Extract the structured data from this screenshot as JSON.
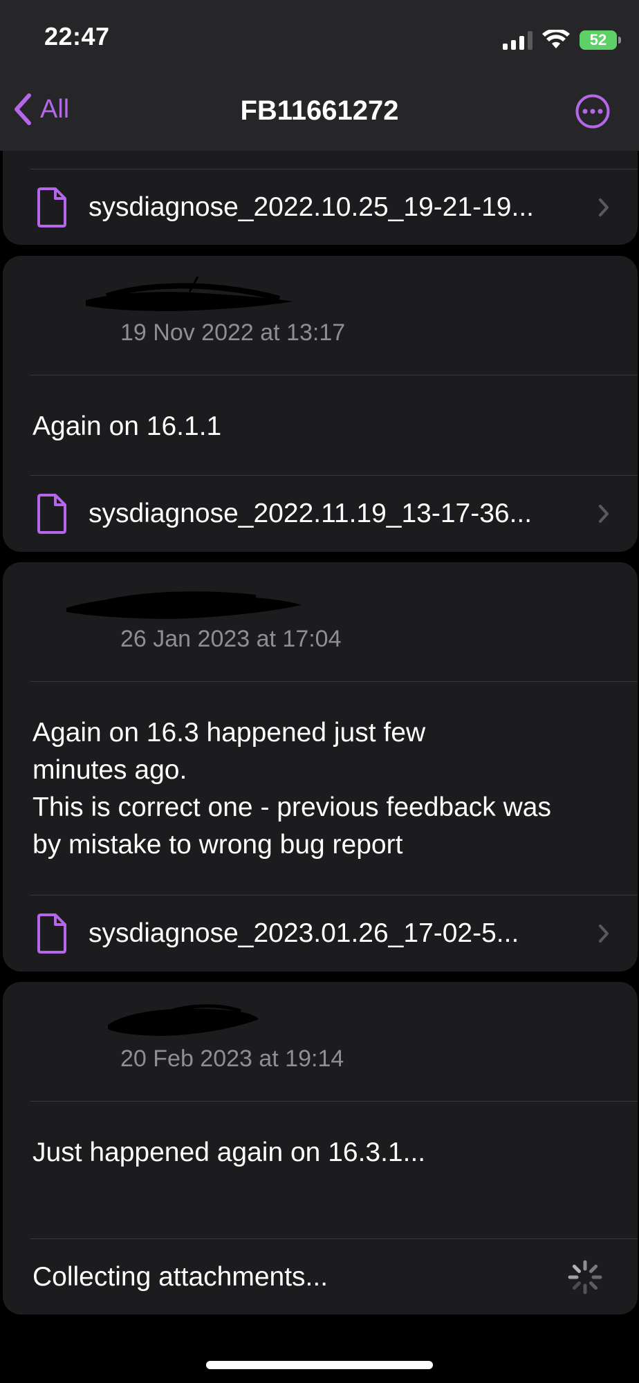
{
  "status_bar": {
    "time": "22:47",
    "battery": "52"
  },
  "nav": {
    "back_label": "All",
    "title": "FB11661272"
  },
  "attachments": {
    "first": "sysdiagnose_2022.10.25_19-21-19...",
    "second": "sysdiagnose_2022.11.19_13-17-36...",
    "third": "sysdiagnose_2023.01.26_17-02-5..."
  },
  "comments": [
    {
      "date": "19 Nov 2022 at 13:17",
      "text": "Again on 16.1.1"
    },
    {
      "date": "26 Jan 2023 at 17:04",
      "lines": [
        "Again on 16.3 happened just few",
        "minutes ago.",
        "This is correct one - previous feedback was",
        "by mistake to wrong bug report"
      ]
    },
    {
      "date": "20 Feb 2023 at 19:14",
      "text": "Just happened again on 16.3.1..."
    }
  ],
  "collecting": {
    "label": "Collecting attachments..."
  },
  "colors": {
    "accent": "#b467e8",
    "background": "#000000",
    "card": "#1c1c1e",
    "secondary_text": "#8e8e93"
  },
  "icons": {
    "back": "chevron-left-icon",
    "more": "ellipsis-circle-icon",
    "file": "document-icon",
    "row": "chevron-right-icon",
    "loading": "spinner-icon"
  }
}
